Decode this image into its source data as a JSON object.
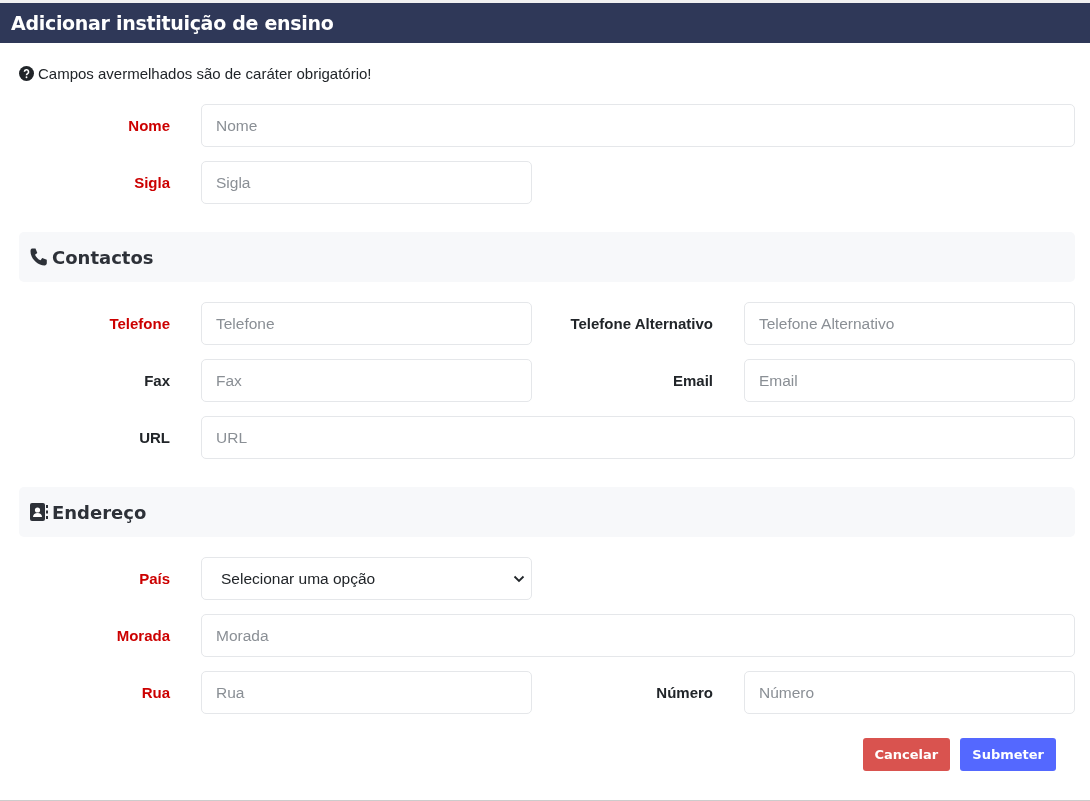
{
  "header": {
    "title": "Adicionar instituição de ensino"
  },
  "notice": "Campos avermelhados são de caráter obrigatório!",
  "general": {
    "rows": [
      {
        "fields": [
          {
            "label": "Nome",
            "required": true,
            "kind": "wide-input",
            "placeholder": "Nome"
          }
        ]
      },
      {
        "fields": [
          {
            "label": "Sigla",
            "required": true,
            "kind": "input",
            "placeholder": "Sigla"
          }
        ]
      }
    ]
  },
  "sections": [
    {
      "heading": "Contactos",
      "rows": [
        {
          "fields": [
            {
              "label": "Telefone",
              "required": true,
              "kind": "input",
              "placeholder": "Telefone"
            },
            {
              "label": "Telefone Alternativo",
              "required": false,
              "kind": "input",
              "placeholder": "Telefone Alternativo"
            }
          ]
        },
        {
          "fields": [
            {
              "label": "Fax",
              "required": false,
              "kind": "input",
              "placeholder": "Fax"
            },
            {
              "label": "Email",
              "required": false,
              "kind": "input",
              "placeholder": "Email"
            }
          ]
        },
        {
          "fields": [
            {
              "label": "URL",
              "required": false,
              "kind": "wide-input",
              "placeholder": "URL"
            }
          ]
        }
      ]
    },
    {
      "heading": "Endereço",
      "rows": [
        {
          "fields": [
            {
              "label": "País",
              "required": true,
              "kind": "select",
              "value": "Selecionar uma opção"
            }
          ]
        },
        {
          "fields": [
            {
              "label": "Morada",
              "required": true,
              "kind": "wide-input",
              "placeholder": "Morada"
            }
          ]
        },
        {
          "fields": [
            {
              "label": "Rua",
              "required": true,
              "kind": "input",
              "placeholder": "Rua"
            },
            {
              "label": "Número",
              "required": false,
              "kind": "input",
              "placeholder": "Número"
            }
          ]
        }
      ]
    }
  ],
  "buttons": [
    {
      "label": "Cancelar",
      "kind": "danger"
    },
    {
      "label": "Submeter",
      "kind": "primary"
    }
  ]
}
